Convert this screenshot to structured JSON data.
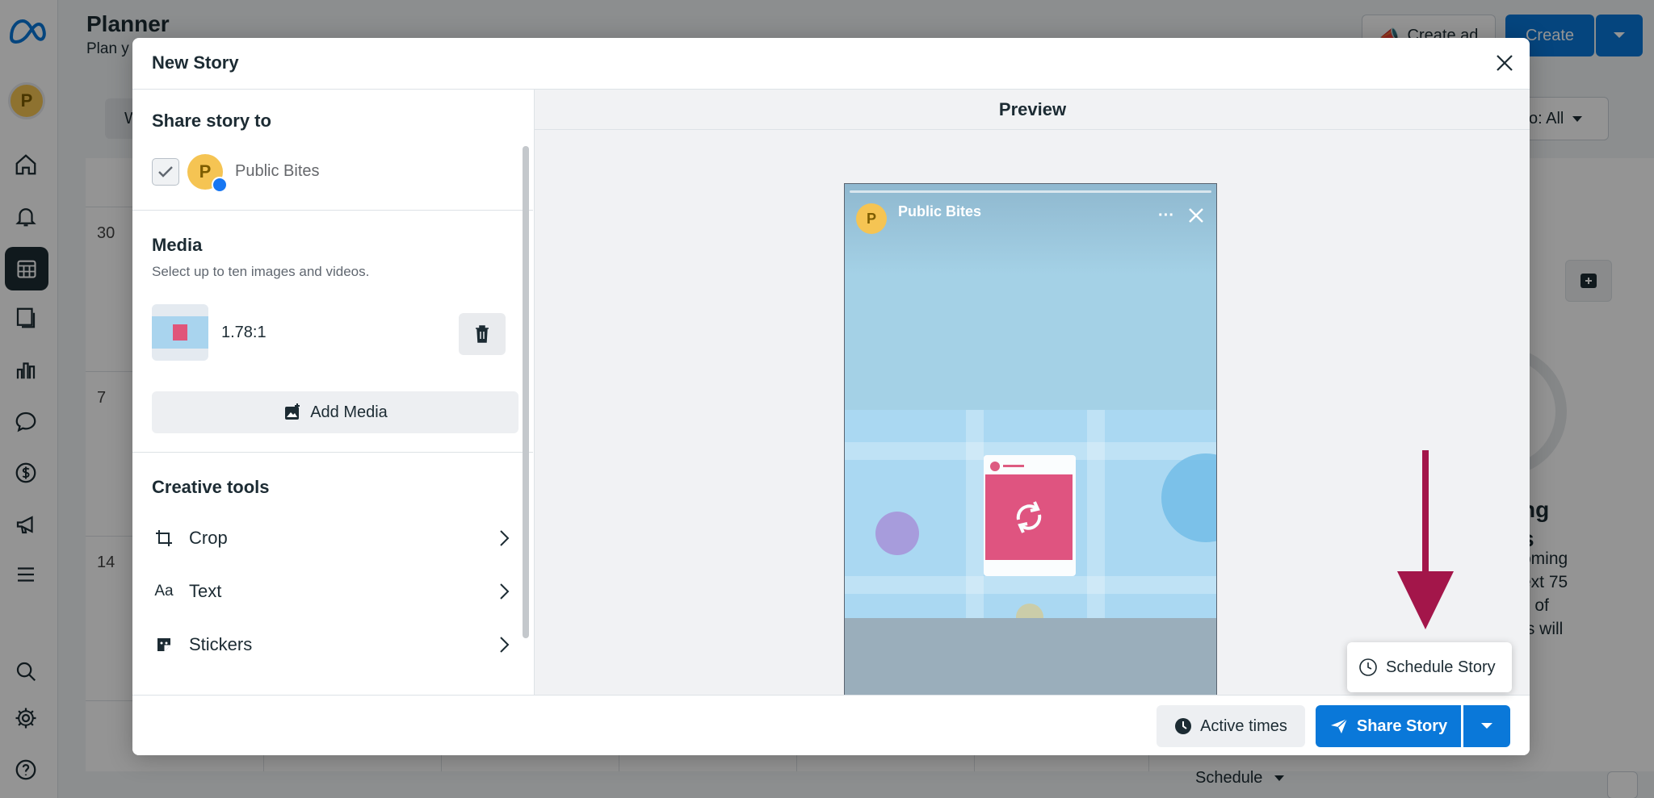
{
  "background": {
    "planner_title": "Planner",
    "planner_subtitle": "Plan y",
    "create_ad_label": "Create ad",
    "create_label": "Create",
    "filter_left": "W",
    "filter_right": "o: All",
    "day_numbers": [
      "30",
      "7",
      "14"
    ],
    "side_heading_lines": [
      "ng",
      "s"
    ],
    "side_text_lines": [
      "oming",
      "ext 75",
      "s of",
      "ts will",
      "."
    ],
    "schedule_label": "Schedule",
    "page_avatar_letter": "P"
  },
  "modal": {
    "title": "New Story",
    "share_section": {
      "title": "Share story to",
      "page_name": "Public Bites",
      "avatar_letter": "P",
      "checked": true
    },
    "media_section": {
      "title": "Media",
      "subtitle": "Select up to ten images and videos.",
      "item_ratio": "1.78:1",
      "add_media_label": "Add Media"
    },
    "creative_tools": {
      "title": "Creative tools",
      "items": [
        {
          "label": "Crop",
          "icon": "crop-icon"
        },
        {
          "label": "Text",
          "icon": "text-icon"
        },
        {
          "label": "Stickers",
          "icon": "sticker-icon"
        }
      ]
    },
    "preview": {
      "title": "Preview",
      "story_name": "Public Bites",
      "story_more": "···",
      "avatar_letter": "P"
    },
    "footer": {
      "active_times_label": "Active times",
      "share_story_label": "Share Story"
    },
    "schedule_popup_label": "Schedule Story"
  },
  "colors": {
    "primary": "#0a78d9",
    "annotation_arrow": "#a3164a",
    "overlay": "rgba(0,0,0,0.42)"
  }
}
